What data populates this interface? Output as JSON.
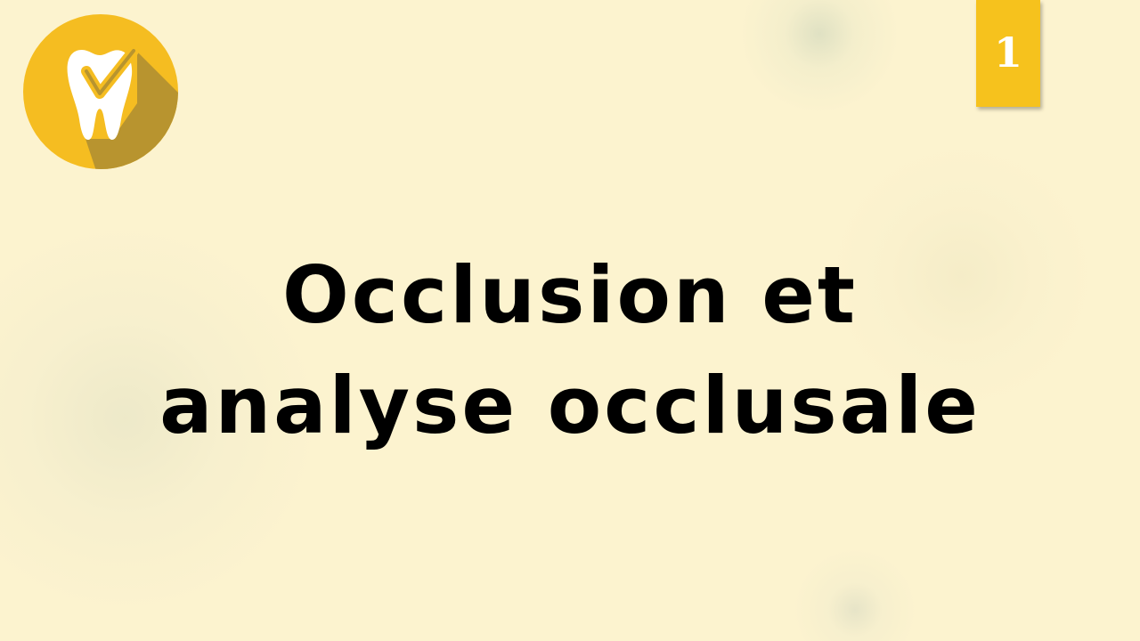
{
  "slide": {
    "page_number": "1",
    "title_line_1": "Occlusion et",
    "title_line_2": "analyse occlusale"
  },
  "logo": {
    "icon": "tooth-check-icon"
  },
  "colors": {
    "background": "#fcf3cf",
    "logo_circle": "#f5bd21",
    "logo_shadow": "#b8942f",
    "badge": "#f6c21d",
    "title_text": "#000000"
  }
}
